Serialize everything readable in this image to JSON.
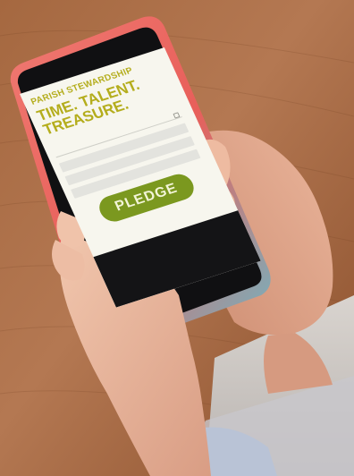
{
  "screen": {
    "header_small": "PARISH STEWARDSHIP",
    "header_large": "TIME. TALENT. TREASURE.",
    "pledge_label": "PLEDGE"
  },
  "colors": {
    "accent_text": "#b4ad1c",
    "pledge_button": "#7b981f",
    "screen_background": "#f7f6ee",
    "phone_case": "#e86a6a",
    "table_wood": "#9a5a34"
  }
}
